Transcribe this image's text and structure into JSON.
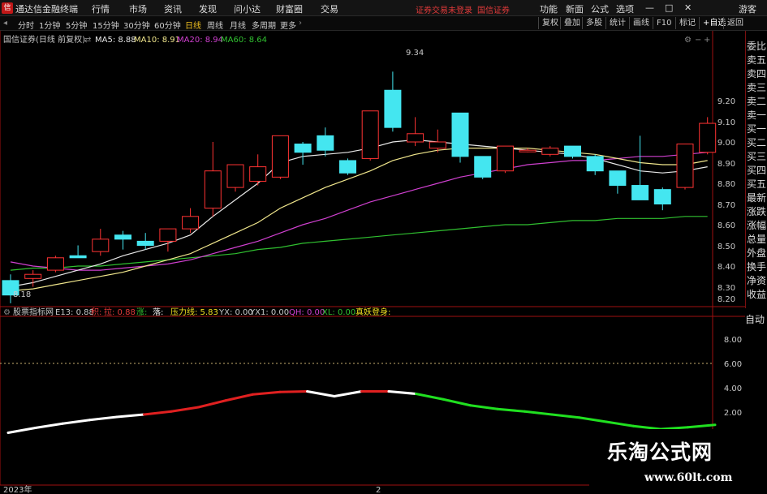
{
  "app": {
    "title": "通达信金融终端"
  },
  "menu": [
    "行情",
    "市场",
    "资讯",
    "发现",
    "问小达",
    "财富圈",
    "交易"
  ],
  "notices": [
    "证券交易未登录",
    "国信证券"
  ],
  "right_menu": [
    "功能",
    "新面",
    "公式",
    "选项"
  ],
  "guest": "游客",
  "periods": {
    "items": [
      "分时",
      "1分钟",
      "5分钟",
      "15分钟",
      "30分钟",
      "60分钟",
      "日线",
      "周线",
      "月线",
      "多周期",
      "更多"
    ],
    "active": "日线"
  },
  "toolbar_right": [
    "复权",
    "叠加",
    "多股",
    "统计",
    "画线",
    "F10",
    "标记",
    "+自选",
    "返回"
  ],
  "main_legend": {
    "stock": "国信证券(日线 前复权)",
    "ma5": "MA5: 8.88",
    "ma10": "MA10: 8.91",
    "ma20": "MA20: 8.94",
    "ma60": "MA60: 8.64"
  },
  "colors": {
    "up": "#ff3333",
    "down": "#44e6f0",
    "ma5": "#e8e8e8",
    "ma10": "#f0e68c",
    "ma20": "#d040d0",
    "ma60": "#30c030",
    "axis": "#a01010"
  },
  "y_ticks_main": [
    "9.20",
    "9.10",
    "9.00",
    "8.90",
    "8.80",
    "8.70",
    "8.60",
    "8.50",
    "8.40",
    "8.30",
    "8.20"
  ],
  "price_marks": {
    "high": "9.34",
    "low": "8.18"
  },
  "candles": [
    {
      "o": 8.33,
      "h": 8.36,
      "l": 8.22,
      "c": 8.26
    },
    {
      "o": 8.34,
      "h": 8.38,
      "l": 8.3,
      "c": 8.36
    },
    {
      "o": 8.38,
      "h": 8.45,
      "l": 8.37,
      "c": 8.44
    },
    {
      "o": 8.45,
      "h": 8.5,
      "l": 8.44,
      "c": 8.44
    },
    {
      "o": 8.47,
      "h": 8.58,
      "l": 8.45,
      "c": 8.53
    },
    {
      "o": 8.55,
      "h": 8.57,
      "l": 8.48,
      "c": 8.53
    },
    {
      "o": 8.52,
      "h": 8.56,
      "l": 8.48,
      "c": 8.5
    },
    {
      "o": 8.52,
      "h": 8.58,
      "l": 8.47,
      "c": 8.58
    },
    {
      "o": 8.58,
      "h": 8.68,
      "l": 8.56,
      "c": 8.64
    },
    {
      "o": 8.68,
      "h": 9.0,
      "l": 8.64,
      "c": 8.86
    },
    {
      "o": 8.78,
      "h": 8.89,
      "l": 8.76,
      "c": 8.89
    },
    {
      "o": 8.81,
      "h": 8.94,
      "l": 8.79,
      "c": 8.88
    },
    {
      "o": 8.83,
      "h": 9.03,
      "l": 8.82,
      "c": 9.03
    },
    {
      "o": 8.99,
      "h": 9.0,
      "l": 8.89,
      "c": 8.95
    },
    {
      "o": 9.03,
      "h": 9.07,
      "l": 8.93,
      "c": 8.96
    },
    {
      "o": 8.91,
      "h": 8.92,
      "l": 8.84,
      "c": 8.85
    },
    {
      "o": 8.92,
      "h": 9.15,
      "l": 8.91,
      "c": 9.15
    },
    {
      "o": 9.25,
      "h": 9.34,
      "l": 9.05,
      "c": 9.07
    },
    {
      "o": 9.0,
      "h": 9.12,
      "l": 8.98,
      "c": 9.04
    },
    {
      "o": 8.97,
      "h": 9.06,
      "l": 8.95,
      "c": 9.0
    },
    {
      "o": 9.14,
      "h": 9.14,
      "l": 8.9,
      "c": 8.93
    },
    {
      "o": 8.93,
      "h": 8.93,
      "l": 8.82,
      "c": 8.83
    },
    {
      "o": 8.86,
      "h": 8.98,
      "l": 8.85,
      "c": 8.98
    },
    {
      "o": 8.96,
      "h": 8.97,
      "l": 8.95,
      "c": 8.96
    },
    {
      "o": 8.94,
      "h": 8.98,
      "l": 8.93,
      "c": 8.97
    },
    {
      "o": 8.98,
      "h": 8.98,
      "l": 8.92,
      "c": 8.93
    },
    {
      "o": 8.93,
      "h": 8.94,
      "l": 8.84,
      "c": 8.86
    },
    {
      "o": 8.86,
      "h": 8.86,
      "l": 8.75,
      "c": 8.79
    },
    {
      "o": 8.79,
      "h": 9.03,
      "l": 8.76,
      "c": 8.72
    },
    {
      "o": 8.77,
      "h": 8.78,
      "l": 8.67,
      "c": 8.7
    },
    {
      "o": 8.78,
      "h": 8.99,
      "l": 8.77,
      "c": 8.99
    },
    {
      "o": 8.95,
      "h": 9.12,
      "l": 8.94,
      "c": 9.09
    }
  ],
  "ma_lines": {
    "ma5": [
      8.3,
      8.32,
      8.35,
      8.38,
      8.41,
      8.45,
      8.48,
      8.51,
      8.55,
      8.64,
      8.72,
      8.8,
      8.9,
      8.93,
      8.94,
      8.95,
      8.97,
      9.0,
      9.01,
      9.0,
      8.99,
      8.98,
      8.97,
      8.96,
      8.95,
      8.94,
      8.92,
      8.89,
      8.86,
      8.85,
      8.86,
      8.88
    ],
    "ma10": [
      8.28,
      8.29,
      8.31,
      8.33,
      8.35,
      8.37,
      8.4,
      8.43,
      8.46,
      8.51,
      8.56,
      8.61,
      8.68,
      8.73,
      8.78,
      8.82,
      8.86,
      8.91,
      8.94,
      8.96,
      8.97,
      8.97,
      8.97,
      8.97,
      8.96,
      8.95,
      8.94,
      8.92,
      8.9,
      8.89,
      8.89,
      8.91
    ],
    "ma20": [
      8.42,
      8.4,
      8.39,
      8.38,
      8.38,
      8.39,
      8.4,
      8.41,
      8.43,
      8.46,
      8.49,
      8.52,
      8.56,
      8.6,
      8.63,
      8.67,
      8.71,
      8.74,
      8.77,
      8.8,
      8.83,
      8.85,
      8.87,
      8.89,
      8.9,
      8.91,
      8.91,
      8.92,
      8.93,
      8.93,
      8.94,
      8.95
    ],
    "ma60": [
      8.38,
      8.39,
      8.39,
      8.4,
      8.4,
      8.41,
      8.42,
      8.43,
      8.44,
      8.45,
      8.46,
      8.48,
      8.49,
      8.51,
      8.52,
      8.53,
      8.54,
      8.55,
      8.56,
      8.57,
      8.58,
      8.59,
      8.6,
      8.6,
      8.61,
      8.62,
      8.62,
      8.63,
      8.63,
      8.63,
      8.64,
      8.64
    ]
  },
  "indicator": {
    "name": "股票指标网",
    "e13": "E13: 0.88",
    "qi": "积:",
    "la": "拉: 0.88",
    "sheng": "涨:",
    "luo": "落:",
    "yali": "压力线: 5.83",
    "yx": "YX: 0.00",
    "yx1": "YX1: 0.00",
    "qh": "QH: 0.00",
    "xl": "XL: 0.00",
    "zhenyao": "真妖登身:"
  },
  "y_ticks_sub": [
    "8.00",
    "6.00",
    "4.00",
    "2.00"
  ],
  "sub_line": [
    0.3,
    0.7,
    1.05,
    1.35,
    1.6,
    1.8,
    2.05,
    2.4,
    2.95,
    3.45,
    3.65,
    3.7,
    3.3,
    3.7,
    3.7,
    3.5,
    3.05,
    2.55,
    2.25,
    2.05,
    1.8,
    1.55,
    1.2,
    0.85,
    0.6,
    0.75,
    0.95
  ],
  "x_labels": [
    "2023年",
    "2"
  ],
  "sidebar": [
    "委比",
    "卖五",
    "卖四",
    "卖三",
    "卖二",
    "卖一",
    "买一",
    "买二",
    "买三",
    "买四",
    "买五",
    "最新",
    "涨跌",
    "涨幅",
    "总量",
    "外盘",
    "换手",
    "净资",
    "收益"
  ],
  "sidebar_bottom": "自动",
  "watermark": {
    "cn": "乐淘公式网",
    "url": "www.60lt.com"
  }
}
